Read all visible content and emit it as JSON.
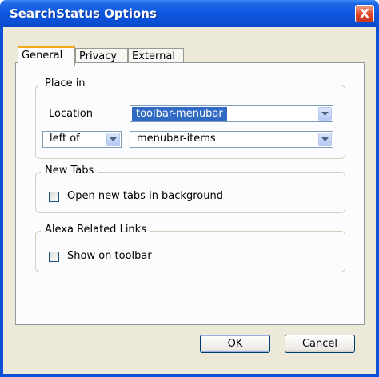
{
  "window": {
    "title": "SearchStatus Options",
    "close_label": "X"
  },
  "tabs": [
    {
      "label": "General"
    },
    {
      "label": "Privacy"
    },
    {
      "label": "External"
    }
  ],
  "place_in": {
    "legend": "Place in",
    "location_label": "Location",
    "location_value": "toolbar-menubar",
    "position_value": "left of",
    "anchor_value": "menubar-items"
  },
  "new_tabs": {
    "legend": "New Tabs",
    "checkbox_label": "Open new tabs in background",
    "checked": false
  },
  "alexa": {
    "legend": "Alexa Related Links",
    "checkbox_label": "Show on toolbar",
    "checked": false
  },
  "buttons": {
    "ok": "OK",
    "cancel": "Cancel"
  },
  "icons": [
    "close-icon",
    "chevron-down-icon"
  ]
}
